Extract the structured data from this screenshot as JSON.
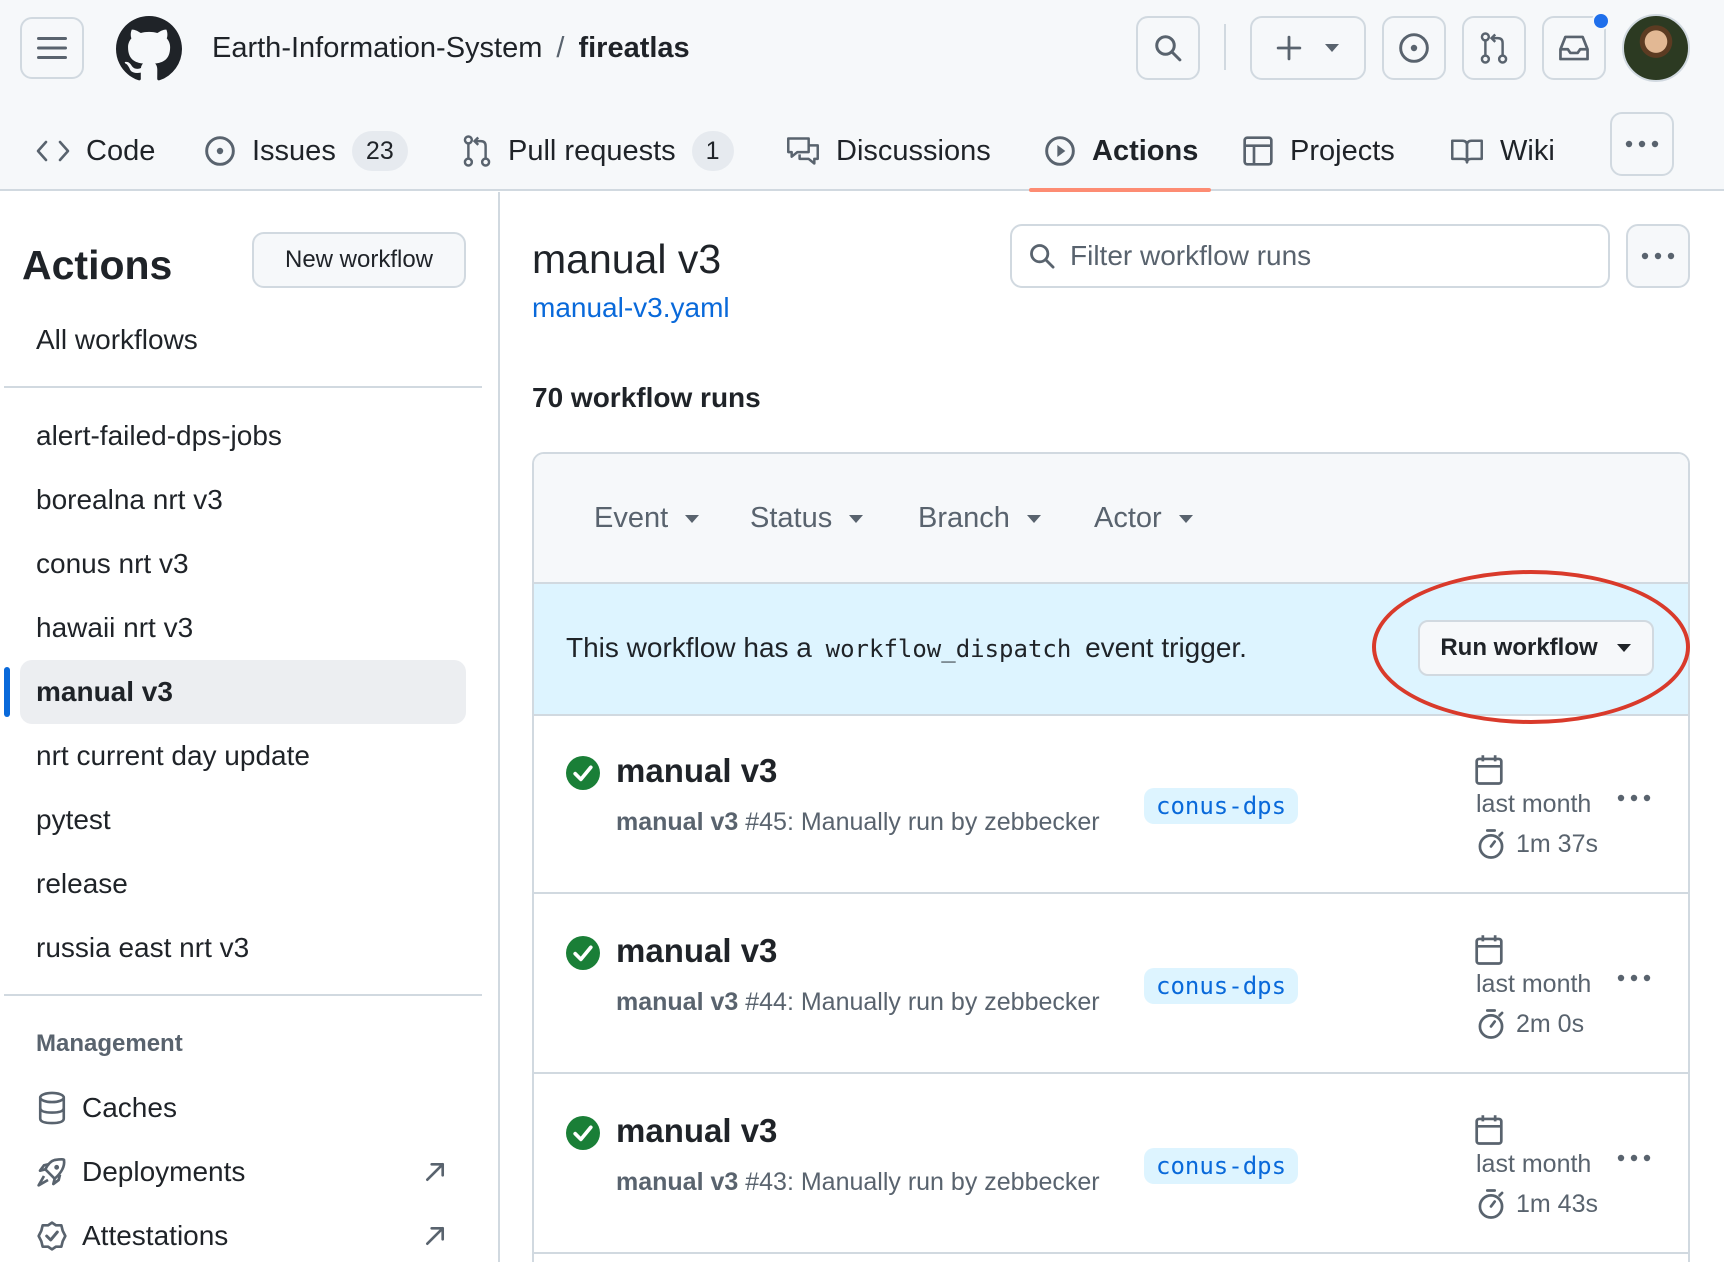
{
  "header": {
    "owner": "Earth-Information-System",
    "separator": "/",
    "repo": "fireatlas",
    "has_notification": true
  },
  "nav": {
    "tabs": [
      {
        "label": "Code",
        "icon": "code-icon"
      },
      {
        "label": "Issues",
        "icon": "issue-icon",
        "counter": "23"
      },
      {
        "label": "Pull requests",
        "icon": "pull-request-icon",
        "counter": "1"
      },
      {
        "label": "Discussions",
        "icon": "discussion-icon"
      },
      {
        "label": "Actions",
        "icon": "play-icon",
        "selected": true
      },
      {
        "label": "Projects",
        "icon": "table-icon"
      },
      {
        "label": "Wiki",
        "icon": "book-icon"
      }
    ]
  },
  "sidebar": {
    "title": "Actions",
    "new_workflow": "New workflow",
    "all_workflows": "All workflows",
    "workflows": [
      "alert-failed-dps-jobs",
      "borealna nrt v3",
      "conus nrt v3",
      "hawaii nrt v3",
      "manual v3",
      "nrt current day update",
      "pytest",
      "release",
      "russia east nrt v3"
    ],
    "active_workflow": "manual v3",
    "management_heading": "Management",
    "management": [
      {
        "label": "Caches",
        "icon": "database-icon"
      },
      {
        "label": "Deployments",
        "icon": "rocket-icon",
        "external": true
      },
      {
        "label": "Attestations",
        "icon": "verified-icon",
        "external": true
      }
    ]
  },
  "main": {
    "title": "manual v3",
    "file": "manual-v3.yaml",
    "filter_placeholder": "Filter workflow runs",
    "run_count": "70 workflow runs",
    "filters": [
      "Event",
      "Status",
      "Branch",
      "Actor"
    ],
    "dispatch": {
      "before": "This workflow has a",
      "code": "workflow_dispatch",
      "after": "event trigger.",
      "button": "Run workflow"
    },
    "runs": [
      {
        "title": "manual v3",
        "workflow": "manual v3",
        "detail": "#45: Manually run by zebbecker",
        "branch": "conus-dps",
        "when": "last month",
        "duration": "1m 37s",
        "status": "success"
      },
      {
        "title": "manual v3",
        "workflow": "manual v3",
        "detail": "#44: Manually run by zebbecker",
        "branch": "conus-dps",
        "when": "last month",
        "duration": "2m 0s",
        "status": "success"
      },
      {
        "title": "manual v3",
        "workflow": "manual v3",
        "detail": "#43: Manually run by zebbecker",
        "branch": "conus-dps",
        "when": "last month",
        "duration": "1m 43s",
        "status": "success"
      }
    ]
  },
  "colors": {
    "accent": "#0969da",
    "success": "#1a7f37",
    "tab_underline": "#fd8c73",
    "annotation": "#d93a2b",
    "dispatch_bg": "#ddf4ff"
  }
}
